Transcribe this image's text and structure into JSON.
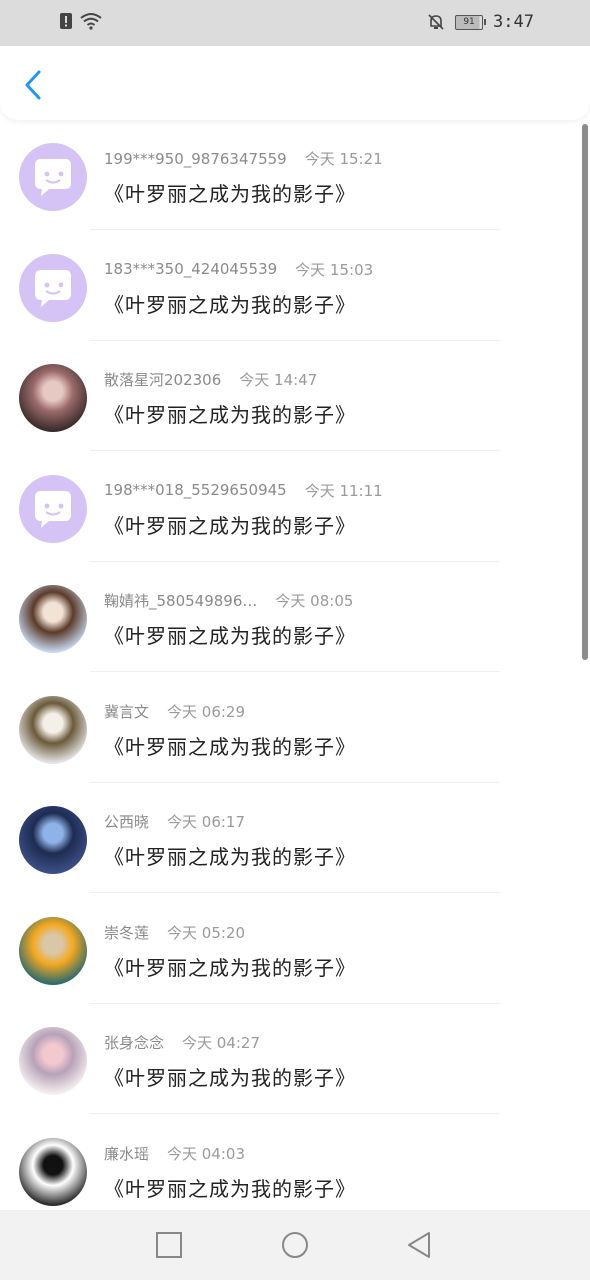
{
  "status_bar": {
    "time": "3:47",
    "battery_level": "91",
    "icons": [
      "alert-icon",
      "wifi-icon",
      "bell-muted-icon",
      "battery-icon"
    ]
  },
  "header": {
    "back_icon": "chevron-left-icon"
  },
  "list": {
    "items": [
      {
        "name": "199***950_9876347559",
        "time": "今天 15:21",
        "title": "《叶罗丽之成为我的影子》",
        "avatar": "default-chat-avatar"
      },
      {
        "name": "183***350_424045539",
        "time": "今天 15:03",
        "title": "《叶罗丽之成为我的影子》",
        "avatar": "default-chat-avatar"
      },
      {
        "name": "散落星河202306",
        "time": "今天 14:47",
        "title": "《叶罗丽之成为我的影子》",
        "avatar": "photo-avatar"
      },
      {
        "name": "198***018_5529650945",
        "time": "今天 11:11",
        "title": "《叶罗丽之成为我的影子》",
        "avatar": "default-chat-avatar"
      },
      {
        "name": "鞠婧祎_580549896…",
        "time": "今天 08:05",
        "title": "《叶罗丽之成为我的影子》",
        "avatar": "photo-avatar"
      },
      {
        "name": "冀言文",
        "time": "今天 06:29",
        "title": "《叶罗丽之成为我的影子》",
        "avatar": "photo-avatar"
      },
      {
        "name": "公西晓",
        "time": "今天 06:17",
        "title": "《叶罗丽之成为我的影子》",
        "avatar": "photo-avatar"
      },
      {
        "name": "崇冬莲",
        "time": "今天 05:20",
        "title": "《叶罗丽之成为我的影子》",
        "avatar": "photo-avatar"
      },
      {
        "name": "张身念念",
        "time": "今天 04:27",
        "title": "《叶罗丽之成为我的影子》",
        "avatar": "photo-avatar"
      },
      {
        "name": "廉水瑶",
        "time": "今天 04:03",
        "title": "《叶罗丽之成为我的影子》",
        "avatar": "photo-avatar"
      }
    ]
  },
  "nav_bar": {
    "icons": [
      "recent-apps-icon",
      "home-icon",
      "back-icon"
    ]
  },
  "colors": {
    "accent": "#2196f3",
    "default_avatar": "#d6c3f5"
  }
}
